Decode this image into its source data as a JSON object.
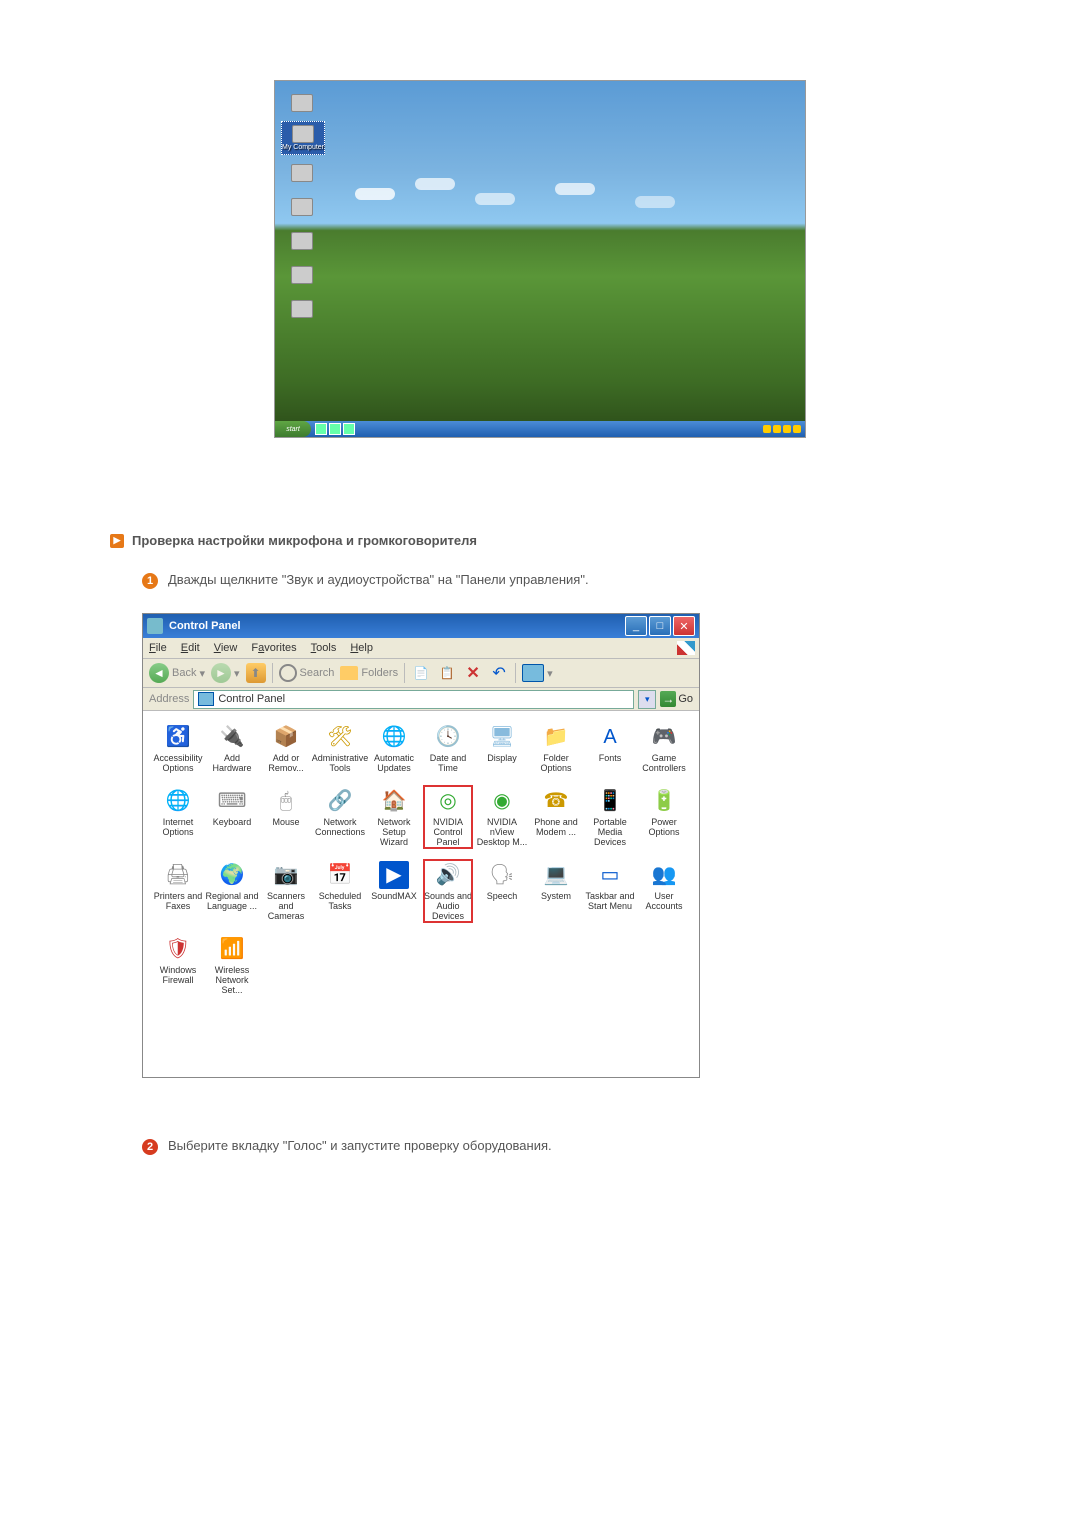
{
  "desktop": {
    "my_computer_label": "My Computer",
    "start_label": "start"
  },
  "section": {
    "title": "Проверка настройки микрофона и громкоговорителя"
  },
  "steps": {
    "s1": "Дважды щелкните \"Звук и аудиоустройства\" на \"Панели управления\".",
    "s2": "Выберите вкладку \"Голос\" и запустите проверку оборудования."
  },
  "cp": {
    "title": "Control Panel",
    "menu": {
      "file": "File",
      "edit": "Edit",
      "view": "View",
      "favorites": "Favorites",
      "tools": "Tools",
      "help": "Help"
    },
    "toolbar": {
      "back": "Back",
      "search": "Search",
      "folders": "Folders"
    },
    "address": {
      "label": "Address",
      "value": "Control Panel",
      "go": "Go"
    },
    "items": [
      {
        "label": "Accessibility Options",
        "ic": "i-acc",
        "g": "♿"
      },
      {
        "label": "Add Hardware",
        "ic": "i-hw",
        "g": "🔌"
      },
      {
        "label": "Add or Remov...",
        "ic": "i-add",
        "g": "📦"
      },
      {
        "label": "Administrative Tools",
        "ic": "i-adm",
        "g": "🛠"
      },
      {
        "label": "Automatic Updates",
        "ic": "i-auto",
        "g": "🌐"
      },
      {
        "label": "Date and Time",
        "ic": "i-date",
        "g": "🕓"
      },
      {
        "label": "Display",
        "ic": "i-disp",
        "g": "🖥"
      },
      {
        "label": "Folder Options",
        "ic": "i-fold",
        "g": "📁"
      },
      {
        "label": "Fonts",
        "ic": "i-font",
        "g": "A"
      },
      {
        "label": "Game Controllers",
        "ic": "i-game",
        "g": "🎮"
      },
      {
        "label": "Internet Options",
        "ic": "i-inet",
        "g": "🌐"
      },
      {
        "label": "Keyboard",
        "ic": "i-kbd",
        "g": "⌨"
      },
      {
        "label": "Mouse",
        "ic": "i-mouse",
        "g": "🖱"
      },
      {
        "label": "Network Connections",
        "ic": "i-net",
        "g": "🔗"
      },
      {
        "label": "Network Setup Wizard",
        "ic": "i-netw",
        "g": "🏠"
      },
      {
        "label": "NVIDIA Control Panel",
        "ic": "i-nvid",
        "g": "◎",
        "hl": true
      },
      {
        "label": "NVIDIA nView Desktop M...",
        "ic": "i-nviv",
        "g": "◉"
      },
      {
        "label": "Phone and Modem ...",
        "ic": "i-phone",
        "g": "☎"
      },
      {
        "label": "Portable Media Devices",
        "ic": "i-port",
        "g": "📱"
      },
      {
        "label": "Power Options",
        "ic": "i-pow",
        "g": "🔋"
      },
      {
        "label": "Printers and Faxes",
        "ic": "i-prin",
        "g": "🖨"
      },
      {
        "label": "Regional and Language ...",
        "ic": "i-reg",
        "g": "🌍"
      },
      {
        "label": "Scanners and Cameras",
        "ic": "i-scan",
        "g": "📷"
      },
      {
        "label": "Scheduled Tasks",
        "ic": "i-sched",
        "g": "📅"
      },
      {
        "label": "SoundMAX",
        "ic": "i-smax",
        "g": "▶"
      },
      {
        "label": "Sounds and Audio Devices",
        "ic": "i-sound",
        "g": "🔊",
        "hl": true
      },
      {
        "label": "Speech",
        "ic": "i-speech",
        "g": "🗣"
      },
      {
        "label": "System",
        "ic": "i-sys",
        "g": "💻"
      },
      {
        "label": "Taskbar and Start Menu",
        "ic": "i-task",
        "g": "▭"
      },
      {
        "label": "User Accounts",
        "ic": "i-user",
        "g": "👥"
      },
      {
        "label": "Windows Firewall",
        "ic": "i-wfw",
        "g": "🛡"
      },
      {
        "label": "Wireless Network Set...",
        "ic": "i-wnet",
        "g": "📶"
      }
    ]
  }
}
